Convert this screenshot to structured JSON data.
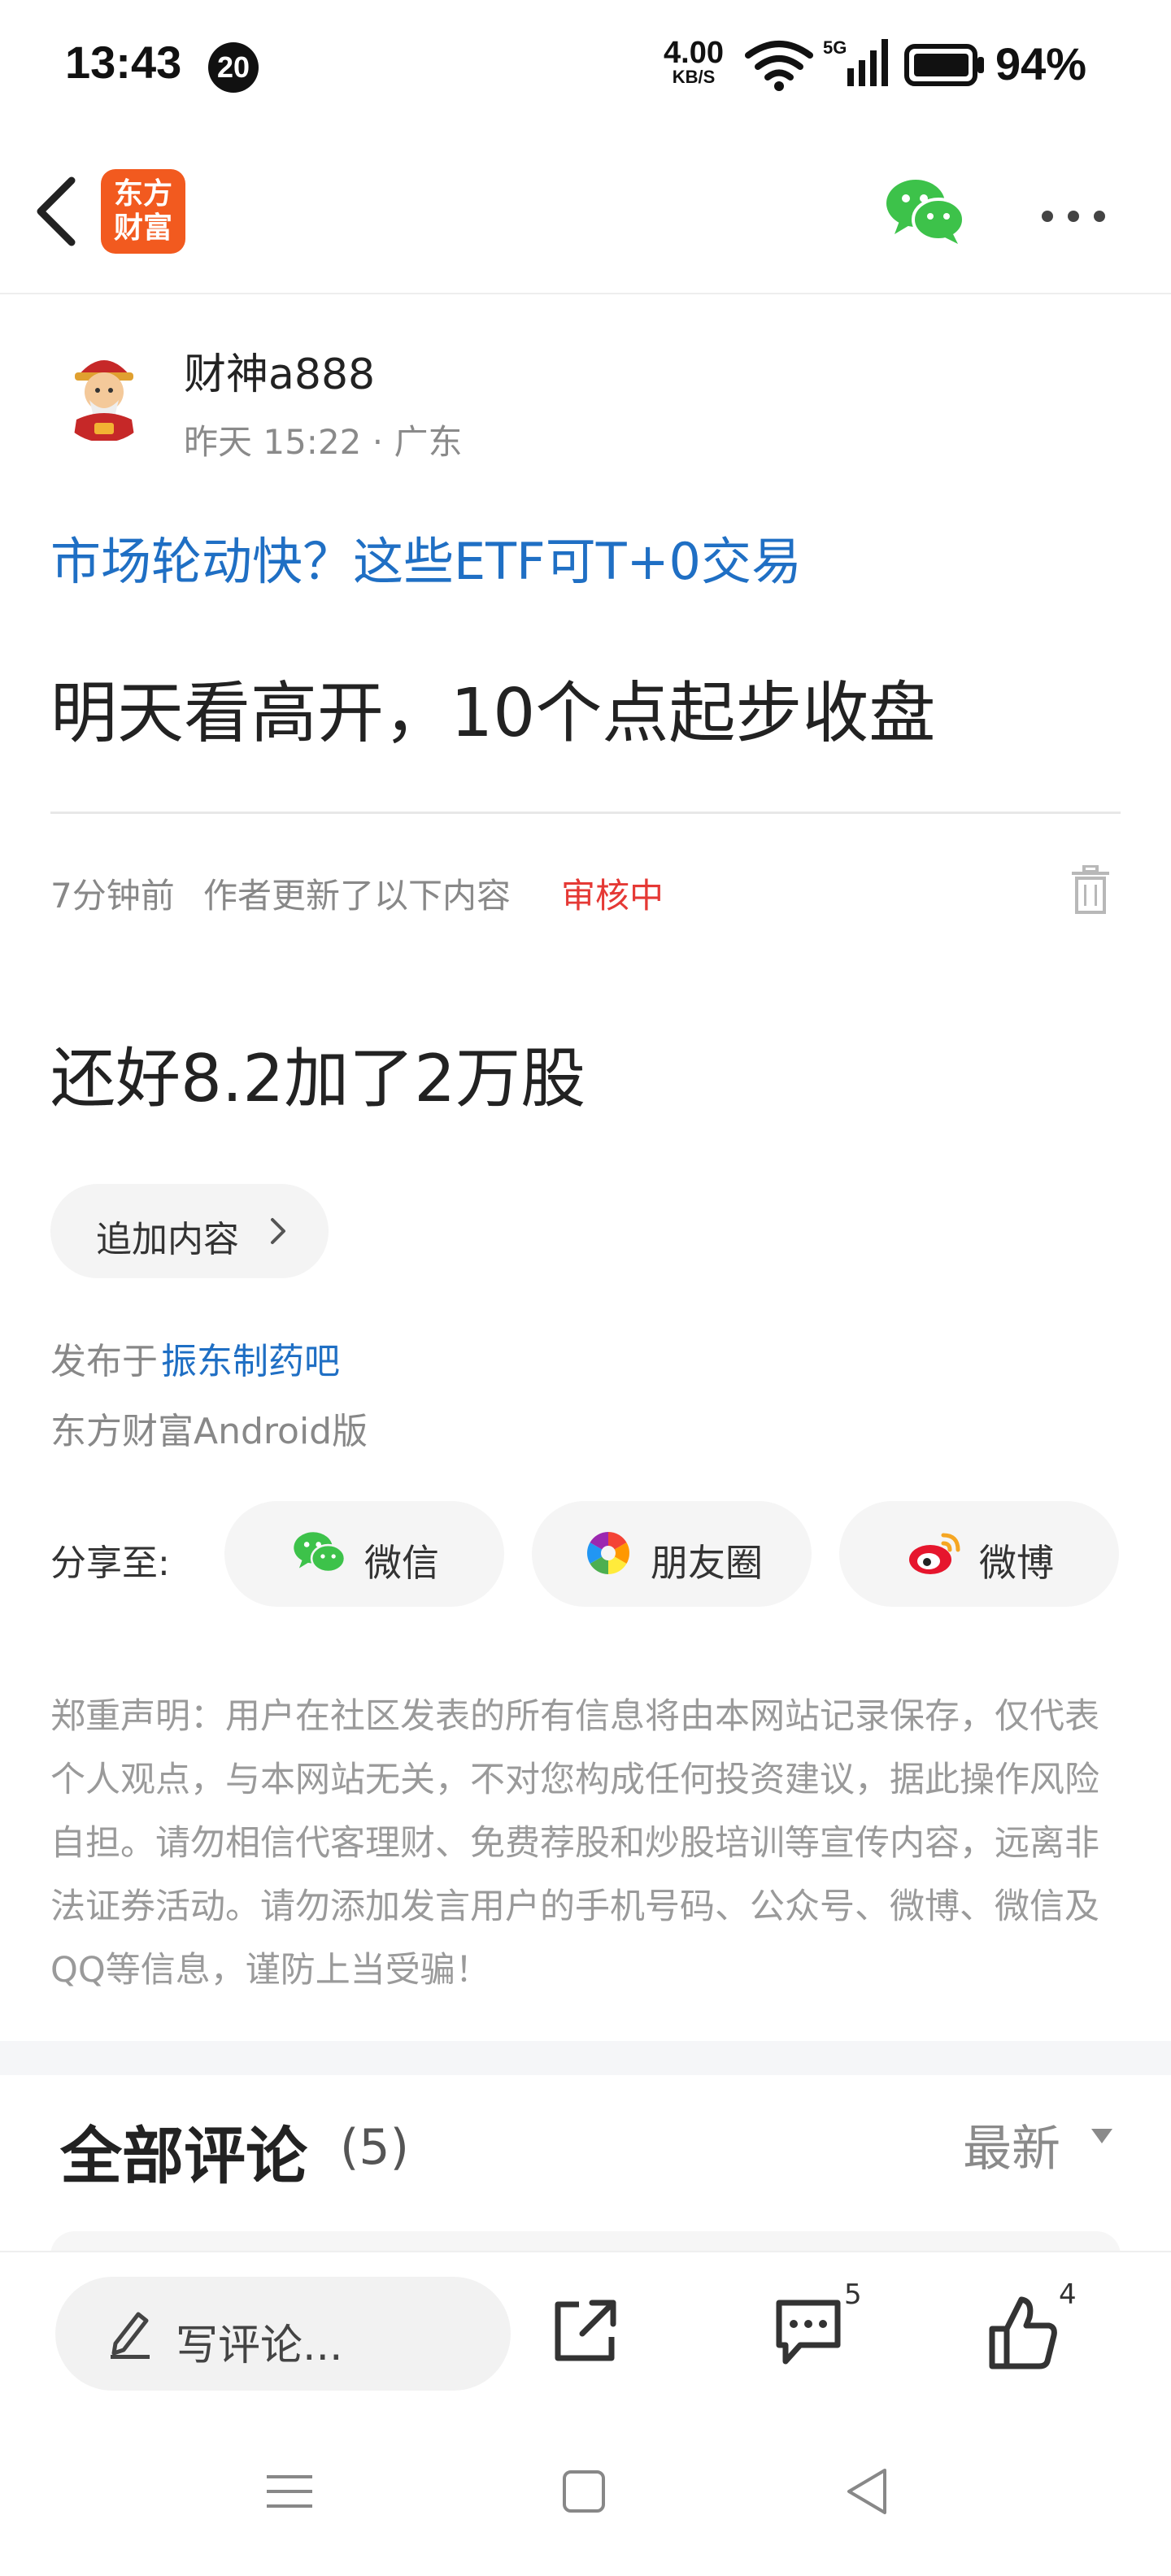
{
  "status_bar": {
    "time": "13:43",
    "notification_count": "20",
    "net_speed_value": "4.00",
    "net_speed_unit": "KB/S",
    "network_type": "5G",
    "battery_percent": "94%"
  },
  "nav": {
    "logo_line1": "东方",
    "logo_line2": "财富",
    "back_icon": "chevron-left-icon",
    "share_icon": "wechat-icon",
    "more_icon": "more-horizontal-icon",
    "brand_color": "#f25a1f"
  },
  "post": {
    "author": "财神a888",
    "meta": "昨天 15:22 · 广东",
    "related_link": "市场轮动快？这些ETF可T+0交易",
    "title": "明天看高开，10个点起步收盘",
    "update_time": "7分钟前",
    "update_note": "作者更新了以下内容",
    "review_status": "审核中",
    "update_body": "还好8.2加了2万股",
    "append_label": "追加内容",
    "published_prefix": "发布于",
    "forum": "振东制药吧",
    "client": "东方财富Android版"
  },
  "share": {
    "label": "分享至:",
    "buttons": [
      {
        "label": "微信",
        "icon": "wechat-icon"
      },
      {
        "label": "朋友圈",
        "icon": "moments-icon"
      },
      {
        "label": "微博",
        "icon": "weibo-icon"
      }
    ]
  },
  "disclaimer": "郑重声明：用户在社区发表的所有信息将由本网站记录保存，仅代表个人观点，与本网站无关，不对您构成任何投资建议，据此操作风险自担。请勿相信代客理财、免费荐股和炒股培训等宣传内容，远离非法证券活动。请勿添加发言用户的手机号码、公众号、微博、微信及QQ等信息，谨防上当受骗！",
  "comments": {
    "title": "全部评论",
    "count": "(5)",
    "sort": "最新"
  },
  "action_bar": {
    "placeholder": "写评论...",
    "comment_count": "5",
    "like_count": "4"
  },
  "colors": {
    "link": "#1f6fc4",
    "review": "#e53935",
    "wechat": "#3dc24a"
  }
}
